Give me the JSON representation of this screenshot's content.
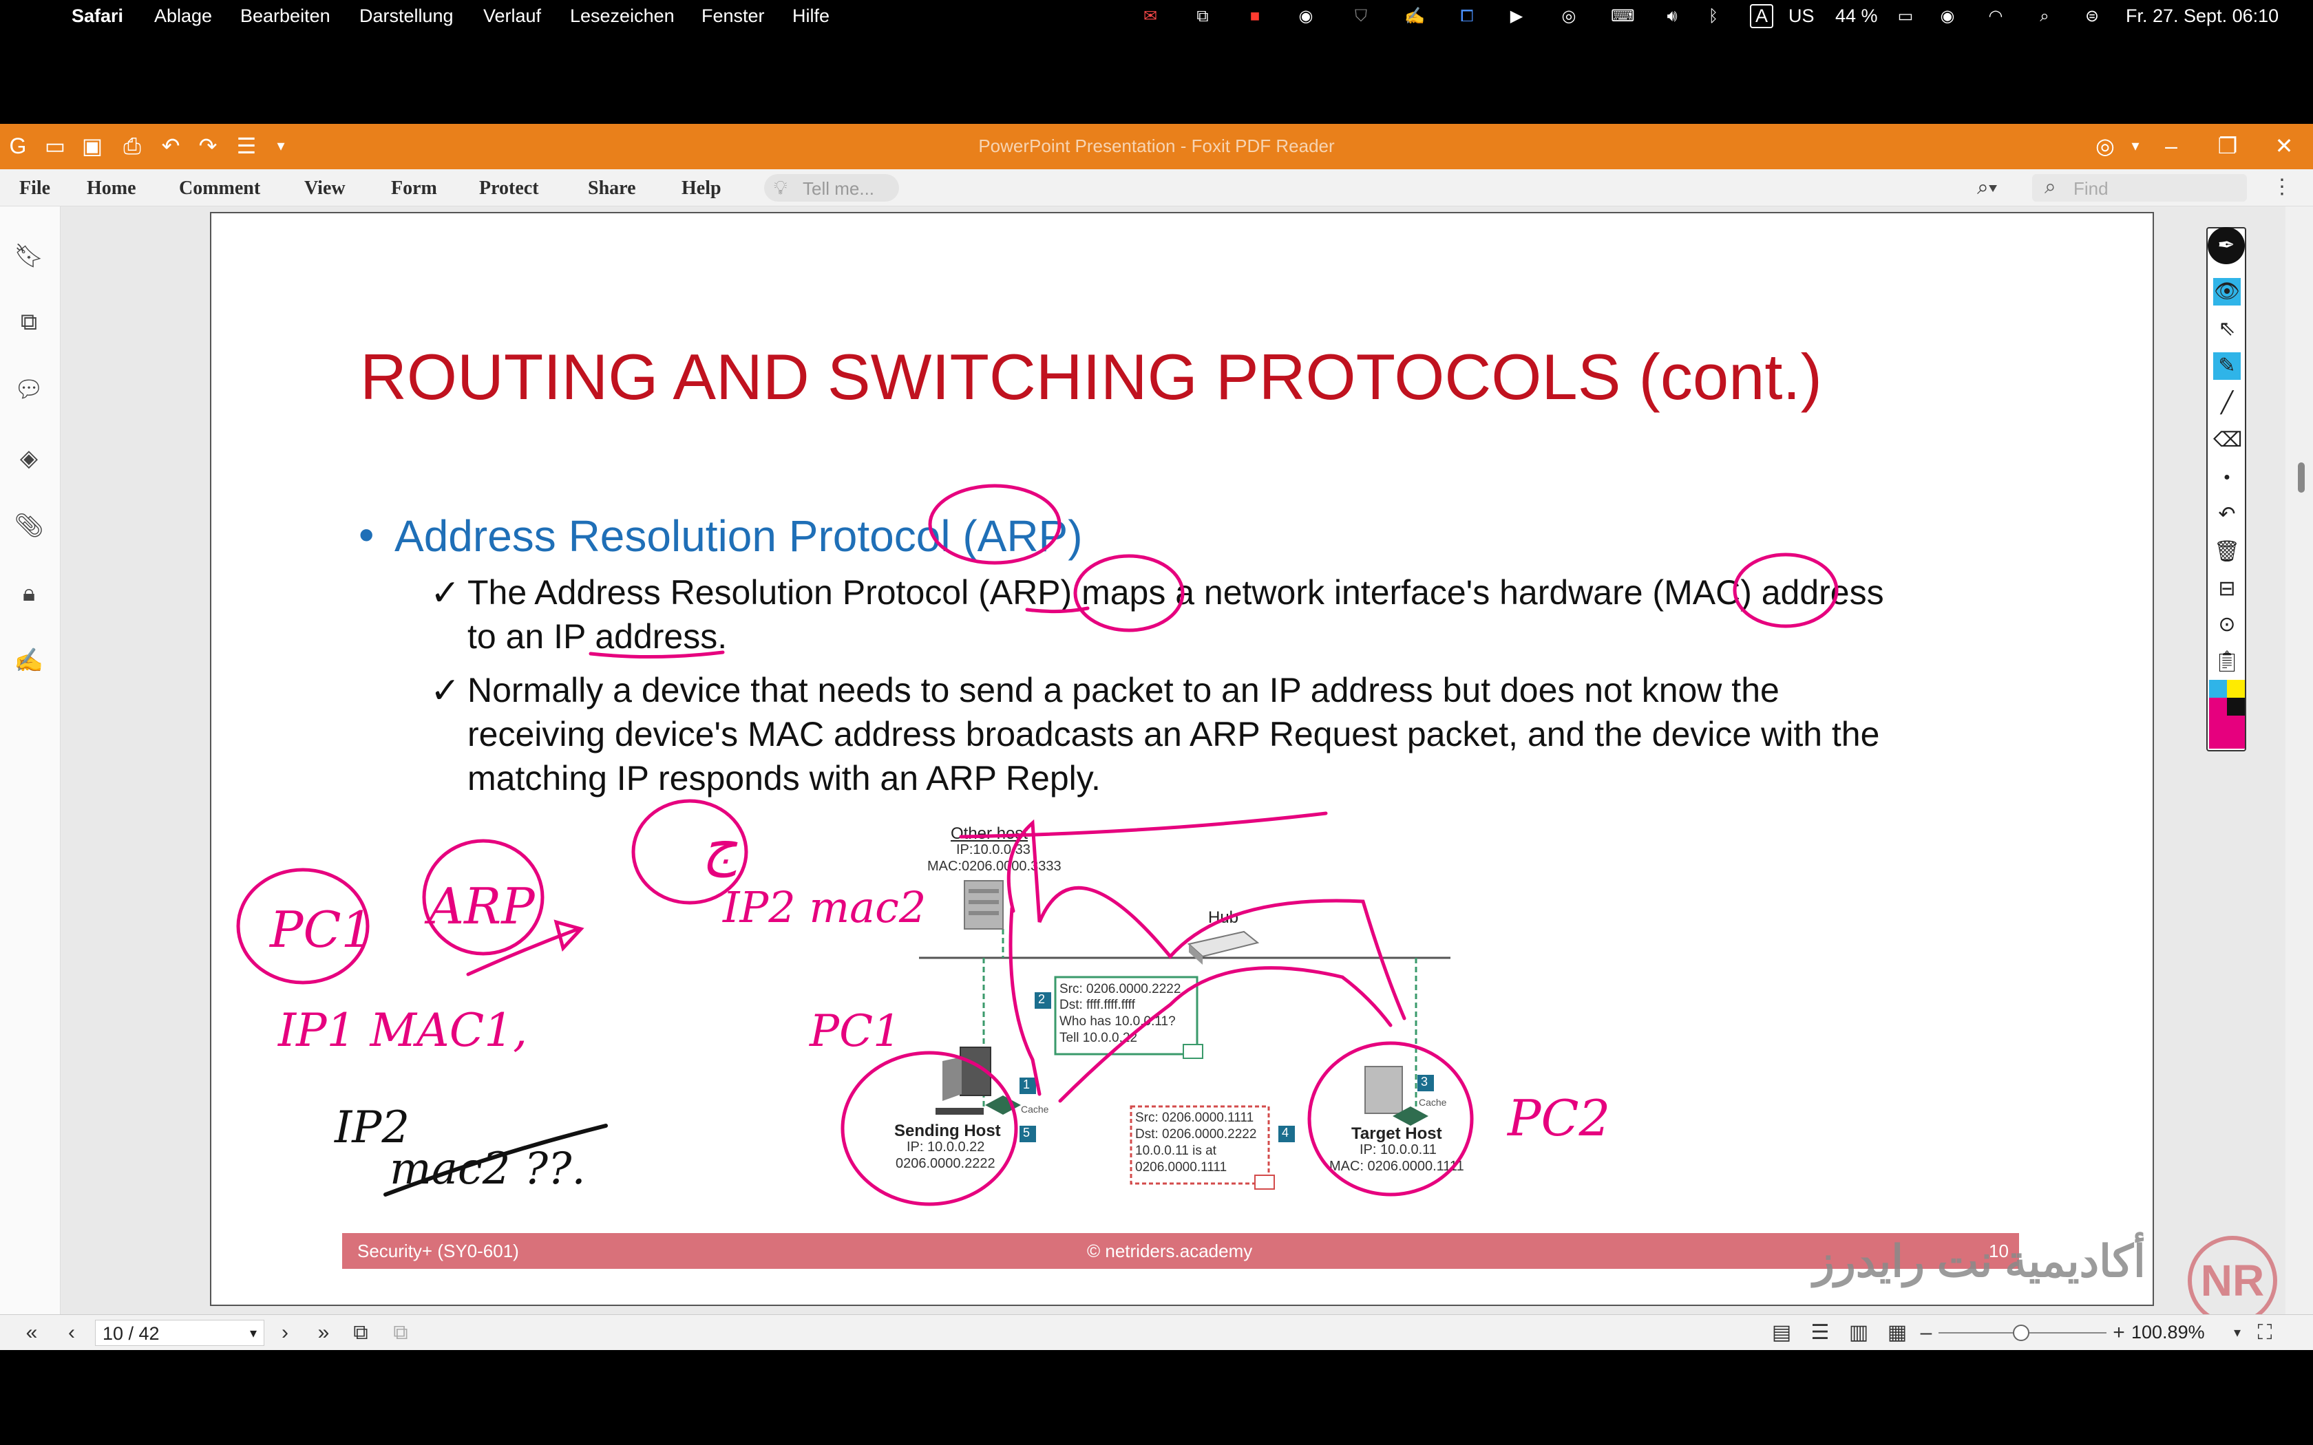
{
  "menubar": {
    "app": "Safari",
    "items": [
      "Ablage",
      "Bearbeiten",
      "Darstellung",
      "Verlauf",
      "Lesezeichen",
      "Fenster",
      "Hilfe"
    ],
    "input_source": "A",
    "keyboard": "US",
    "battery": "44 %",
    "datetime": "Fr. 27. Sept. 06:10"
  },
  "window": {
    "title": "PowerPoint Presentation - Foxit PDF Reader"
  },
  "ribbon": {
    "menus": [
      "File",
      "Home",
      "Comment",
      "View",
      "Form",
      "Protect",
      "Share",
      "Help"
    ],
    "tell_me_placeholder": "Tell me...",
    "find_placeholder": "Find"
  },
  "slide": {
    "title": "ROUTING AND SWITCHING PROTOCOLS (cont.)",
    "bullet": "Address Resolution Protocol (ARP)",
    "sub1_line1": "The Address Resolution Protocol (ARP) maps a network interface's hardware (MAC) address",
    "sub1_line2": "to an IP address.",
    "sub2_line1": "Normally a device that needs to send a packet to an IP address but does not know the",
    "sub2_line2": "receiving device's MAC address broadcasts an ARP Request packet, and the device with the",
    "sub2_line3": "matching IP responds with an ARP Reply.",
    "footer_left": "Security+ (SY0-601)",
    "footer_center": "© netriders.academy",
    "footer_page": "10"
  },
  "diagram": {
    "other_host": {
      "name": "Other host",
      "ip": "IP:10.0.0.33",
      "mac": "MAC:0206.0000.3333"
    },
    "hub": "Hub",
    "sending_host": {
      "name": "Sending Host",
      "ip": "IP: 10.0.0.22",
      "mac": "0206.0000.2222"
    },
    "target_host": {
      "name": "Target Host",
      "ip": "IP: 10.0.0.11",
      "mac": "MAC: 0206.0000.1111"
    },
    "request": [
      "Src: 0206.0000.2222",
      "Dst: ffff.ffff.ffff",
      "Who has 10.0.0.11?",
      "Tell 10.0.0.22"
    ],
    "reply": [
      "Src: 0206.0000.1111",
      "Dst: 0206.0000.2222",
      "10.0.0.11 is at",
      "0206.0000.1111"
    ],
    "steps": [
      "1",
      "2",
      "3",
      "4",
      "5"
    ],
    "cache": "Cache"
  },
  "annotations": {
    "pc1": "PC1",
    "arp": "ARP",
    "ip1_mac1": "IP1 MAC1,",
    "ip2": "IP2",
    "mac2": "mac2 ??.",
    "ip2_mac2": "IP2 mac2",
    "pc1_left": "PC1",
    "pc2": "PC2"
  },
  "statusbar": {
    "page": "10 / 42",
    "zoom": "100.89%"
  },
  "watermark": {
    "text": "أكاديمية نت رايدرز",
    "logo": "NR"
  },
  "colors": {
    "accent": "#e9801b",
    "title_red": "#c0121f",
    "bullet_blue": "#1f6fb7",
    "ink": "#e6007e",
    "footer": "#d9717a"
  }
}
